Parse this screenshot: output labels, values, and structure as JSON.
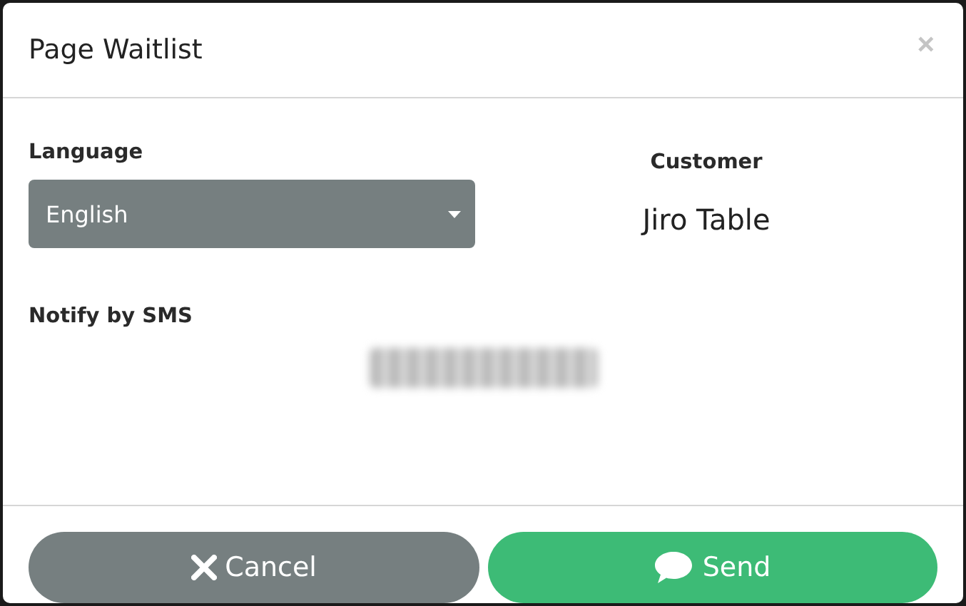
{
  "dialog": {
    "title": "Page Waitlist",
    "close": "×"
  },
  "language": {
    "label": "Language",
    "value": "English"
  },
  "customer": {
    "label": "Customer",
    "name": "Jiro Table"
  },
  "sms": {
    "label": "Notify by SMS"
  },
  "buttons": [
    {
      "kind": "cancel",
      "label": "Cancel"
    },
    {
      "kind": "send",
      "label": "Send"
    }
  ]
}
